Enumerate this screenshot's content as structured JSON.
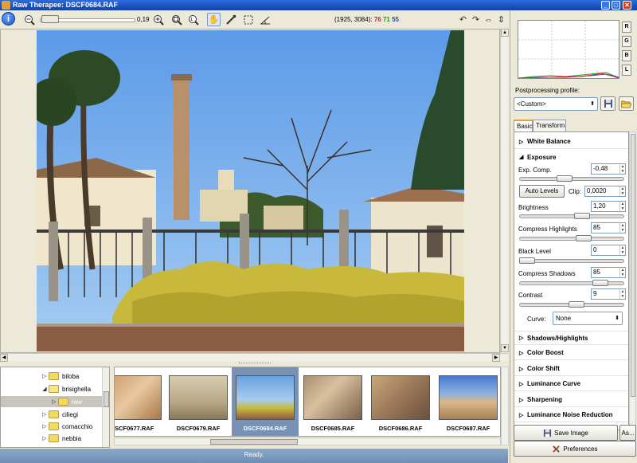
{
  "window": {
    "title": "Raw Therapee: DSCF0684.RAF",
    "minimize": "_",
    "maximize": "□",
    "close": "✕"
  },
  "toolbar": {
    "zoom_value": "0,19",
    "coords": "(1925, 3084):",
    "rgb": {
      "r": "76",
      "g": "71",
      "b": "55"
    },
    "icons": [
      "info-icon",
      "zoom-out-icon",
      "zoom-in-icon",
      "zoom-fit-icon",
      "zoom-100-icon",
      "hand-icon",
      "color-picker-icon",
      "crop-icon",
      "straighten-icon",
      "rotate-left-icon",
      "rotate-right-icon",
      "flip-horizontal-icon",
      "flip-vertical-icon"
    ]
  },
  "folder_tree": {
    "items": [
      {
        "label": "biloba",
        "expander": "▷",
        "selected": false
      },
      {
        "label": "brisighella",
        "expander": "◢",
        "selected": false
      },
      {
        "label": "raw",
        "expander": "▷",
        "selected": true
      },
      {
        "label": "ciliegi",
        "expander": "▷",
        "selected": false
      },
      {
        "label": "comacchio",
        "expander": "▷",
        "selected": false
      },
      {
        "label": "nebbia",
        "expander": "▷",
        "selected": false
      }
    ]
  },
  "filmstrip": {
    "thumbnails": [
      {
        "label": "DSCF0677.RAF",
        "selected": false
      },
      {
        "label": "DSCF0679.RAF",
        "selected": false
      },
      {
        "label": "DSCF0684.RAF",
        "selected": true
      },
      {
        "label": "DSCF0685.RAF",
        "selected": false
      },
      {
        "label": "DSCF0686.RAF",
        "selected": false
      },
      {
        "label": "DSCF0687.RAF",
        "selected": false
      }
    ]
  },
  "status": {
    "text": "Ready."
  },
  "histogram": {
    "buttons": [
      "R",
      "G",
      "B",
      "L"
    ]
  },
  "postprocessing": {
    "label": "Postprocessing profile:",
    "profile": "<Custom>"
  },
  "tabs": [
    "Basic",
    "Transform"
  ],
  "panel": {
    "white_balance": "White Balance",
    "exposure": "Exposure",
    "exp_comp_label": "Exp. Comp.",
    "exp_comp_value": "-0,48",
    "exp_comp_level": 0.42,
    "auto_levels": "Auto Levels",
    "clip_label": "Clip:",
    "clip_value": "0,0020",
    "brightness_label": "Brightness",
    "brightness_value": "1,20",
    "brightness_level": 0.62,
    "compress_highlights_label": "Compress Highlights",
    "compress_highlights_value": "85",
    "compress_highlights_level": 0.63,
    "black_level_label": "Black Level",
    "black_level_value": "0",
    "black_level_level": 0.0,
    "compress_shadows_label": "Compress Shadows",
    "compress_shadows_value": "85",
    "compress_shadows_level": 0.82,
    "contrast_label": "Contrast",
    "contrast_value": "9",
    "contrast_level": 0.55,
    "curve_label": "Curve:",
    "curve_value": "None",
    "sections_below": [
      "Shadows/Highlights",
      "Color Boost",
      "Color Shift",
      "Luminance Curve",
      "Sharpening",
      "Luminance Noise Reduction"
    ]
  },
  "bottom_buttons": {
    "save_image": "Save Image",
    "save_as": "As...",
    "preferences": "Preferences"
  }
}
